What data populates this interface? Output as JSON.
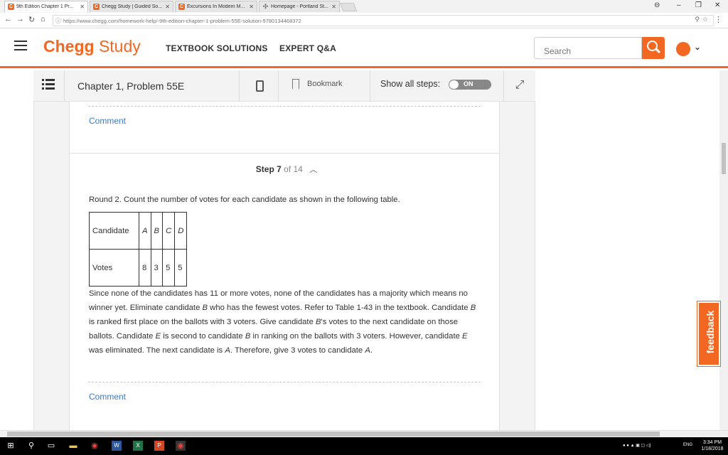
{
  "browser": {
    "tabs": [
      {
        "label": "9th Edition Chapter 1 Pr..."
      },
      {
        "label": "Chegg Study | Guided So..."
      },
      {
        "label": "Excursions In Modern M..."
      },
      {
        "label": "Homepage - Portland St..."
      }
    ],
    "url": "https://www.chegg.com/homework-help/-9th-edition-chapter-1-problem-55E-solution-9780134468372"
  },
  "header": {
    "logo_chegg": "Chegg",
    "logo_study": " Study",
    "nav": [
      "TEXTBOOK SOLUTIONS",
      "EXPERT Q&A"
    ],
    "search_placeholder": "Search"
  },
  "toolbar": {
    "chapter_title": "Chapter 1, Problem 55E",
    "bookmark_label": "Bookmark",
    "show_steps_label": "Show all steps:",
    "toggle_state": "ON"
  },
  "solution": {
    "comment_label": "Comment",
    "step_label": "Step 7",
    "step_of": "of 14",
    "intro": "Round 2. Count the number of votes for each candidate as shown in the following table.",
    "table": {
      "row_labels": [
        "Candidate",
        "Votes"
      ],
      "candidates": [
        "A",
        "B",
        "C",
        "D"
      ],
      "votes": [
        "8",
        "3",
        "5",
        "5"
      ]
    },
    "paragraph_parts": [
      {
        "t": "Since none of the candidates has 11 or more votes, none of the candidates has a majority which means no winner yet. Eliminate candidate ",
        "i": false
      },
      {
        "t": "B",
        "i": true
      },
      {
        "t": " who has the fewest votes. Refer to Table 1-43 in the textbook. Candidate ",
        "i": false
      },
      {
        "t": "B",
        "i": true
      },
      {
        "t": " is ranked first place on the ballots with 3 voters. Give candidate ",
        "i": false
      },
      {
        "t": "B",
        "i": true
      },
      {
        "t": "'s votes to the next candidate on those ballots. Candidate ",
        "i": false
      },
      {
        "t": "E",
        "i": true
      },
      {
        "t": " is second to candidate ",
        "i": false
      },
      {
        "t": "B",
        "i": true
      },
      {
        "t": " in ranking on the ballots with 3 voters. However, candidate ",
        "i": false
      },
      {
        "t": "E",
        "i": true
      },
      {
        "t": " was eliminated. The next candidate is ",
        "i": false
      },
      {
        "t": "A",
        "i": true
      },
      {
        "t": ". Therefore, give 3 votes to candidate ",
        "i": false
      },
      {
        "t": "A",
        "i": true
      },
      {
        "t": ".",
        "i": false
      }
    ]
  },
  "feedback_label": "feedback",
  "taskbar": {
    "time": "3:34 PM",
    "date": "1/18/2018",
    "lang": "ENG"
  },
  "colors": {
    "brand": "#f26722",
    "link": "#3a7bc8"
  }
}
